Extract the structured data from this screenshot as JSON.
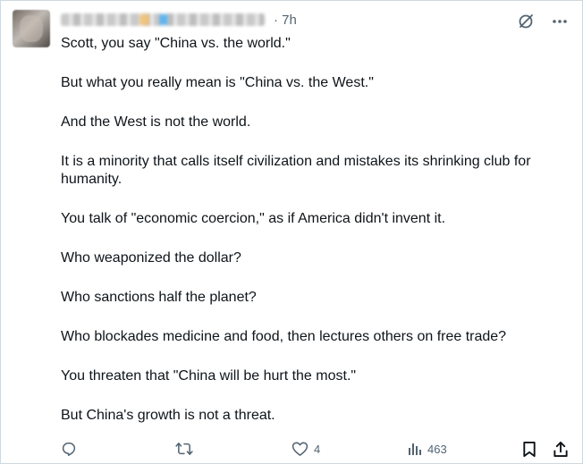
{
  "post": {
    "time": "· 7h",
    "paragraphs": [
      "Scott, you say \"China vs. the world.\"",
      "But what you really mean is \"China vs. the West.\"",
      "And the West is not the world.",
      "It is a minority that calls itself civilization and mistakes its shrinking club for humanity.",
      "You talk of \"economic coercion,\" as if America didn't invent it.",
      "Who weaponized the dollar?",
      "Who sanctions half the planet?",
      "Who blockades medicine and food, then lectures others on free trade?",
      "You threaten that \"China will be hurt the most.\"",
      "But China's growth is not a threat."
    ]
  },
  "actions": {
    "likes": "4",
    "views": "463"
  },
  "icons": {
    "grok": "grok-icon",
    "more": "more-icon",
    "reply": "reply-icon",
    "repost": "repost-icon",
    "like": "heart-icon",
    "views": "views-icon",
    "bookmark": "bookmark-icon",
    "share": "share-icon"
  },
  "colors": {
    "text": "#0f1419",
    "muted": "#536471",
    "border": "#cfd9de"
  }
}
